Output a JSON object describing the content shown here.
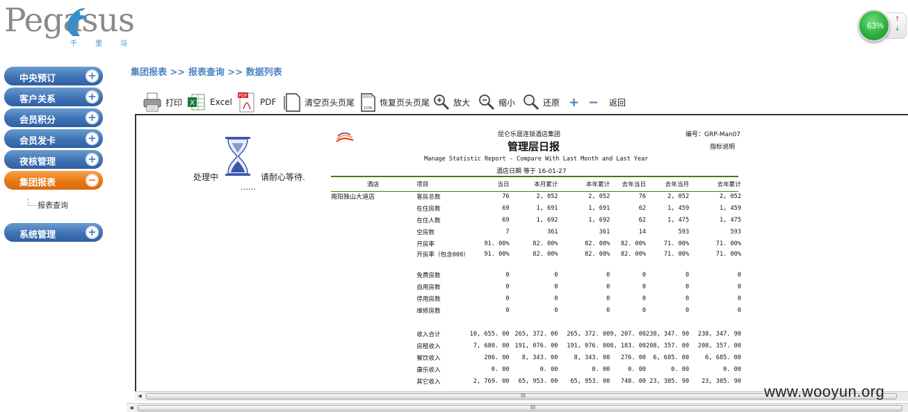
{
  "logo": {
    "text": "Pegasus",
    "subtitle": "千里马"
  },
  "gauge": {
    "value": "63%",
    "color": "#2fae3f"
  },
  "sidebar": {
    "items": [
      {
        "label": "中央预订",
        "icon": "plus-icon"
      },
      {
        "label": "客户关系",
        "icon": "plus-icon"
      },
      {
        "label": "会员积分",
        "icon": "plus-icon"
      },
      {
        "label": "会员发卡",
        "icon": "plus-icon"
      },
      {
        "label": "夜核管理",
        "icon": "plus-icon"
      },
      {
        "label": "集团报表",
        "icon": "minus-icon",
        "active": true
      },
      {
        "label": "系统管理",
        "icon": "plus-icon"
      }
    ],
    "sub_item": "报表查询",
    "colors": {
      "normal": "#3f72b4",
      "active": "#e77716"
    }
  },
  "breadcrumb": "集团报表 >> 报表查询 >> 数据列表",
  "toolbar": {
    "print": "打印",
    "excel": "Excel",
    "pdf": "PDF",
    "clear_header": "清空页头页尾",
    "restore_header": "恢复页头页尾",
    "zoom_in": "放大",
    "zoom_out": "缩小",
    "reset": "还原",
    "plus": "+",
    "minus": "−",
    "back": "返回"
  },
  "loading": {
    "left": "处理中",
    "right": "请耐心等待.",
    "dots": "……"
  },
  "report": {
    "group": "昆仑乐居连锁酒店集团",
    "code": "编号：GRP-Man07",
    "title": "管理层日报",
    "description_link": "指标说明",
    "subtitle": "Manage Statistic Report - Compare With Last Month and Last Year",
    "date": "酒店日期 等于 16-01-27",
    "headers": [
      "酒店",
      "项目",
      "当日",
      "本月累计",
      "本年累计",
      "去年当日",
      "去年当月",
      "去年累计"
    ],
    "hotel": "南阳独山大道店",
    "rows": [
      [
        "客房总数",
        "76",
        "2, 052",
        "2, 052",
        "76",
        "2, 052",
        "2, 052"
      ],
      [
        "在住房数",
        "69",
        "1, 691",
        "1, 691",
        "62",
        "1, 459",
        "1, 459"
      ],
      [
        "在住人数",
        "69",
        "1, 692",
        "1, 692",
        "62",
        "1, 475",
        "1, 475"
      ],
      [
        "空房数",
        "7",
        "361",
        "361",
        "14",
        "593",
        "593"
      ],
      [
        "开房率",
        "91. 00%",
        "82. 00%",
        "82. 00%",
        "82. 00%",
        "71. 00%",
        "71. 00%"
      ],
      [
        "开房率（包含000）",
        "91. 00%",
        "82. 00%",
        "82. 00%",
        "82. 00%",
        "71. 00%",
        "71. 00%"
      ],
      [
        "免费房数",
        "0",
        "0",
        "0",
        "0",
        "0",
        "0"
      ],
      [
        "自用房数",
        "0",
        "0",
        "0",
        "0",
        "0",
        "0"
      ],
      [
        "停用房数",
        "0",
        "0",
        "0",
        "0",
        "0",
        "0"
      ],
      [
        "维修房数",
        "0",
        "0",
        "0",
        "0",
        "0",
        "0"
      ],
      [
        "",
        "",
        "",
        "",
        "",
        "",
        ""
      ],
      [
        "收入合计",
        "10, 655. 00",
        "265, 372. 00",
        "265, 372. 00",
        "9, 207. 00",
        "238, 347. 90",
        "238, 347. 90"
      ],
      [
        "房租收入",
        "7, 680. 00",
        "191, 076. 00",
        "191, 076. 00",
        "8, 183. 00",
        "208, 357. 00",
        "208, 357. 00"
      ],
      [
        "餐饮收入",
        "206. 00",
        "8, 343. 00",
        "8, 343. 00",
        "276. 00",
        "6, 685. 00",
        "6, 685. 00"
      ],
      [
        "康乐收入",
        "0. 00",
        "0. 00",
        "0. 00",
        "0. 00",
        "0. 00",
        "0. 00"
      ],
      [
        "其它收入",
        "2, 769. 00",
        "65, 953. 00",
        "65, 953. 00",
        "748. 00",
        "23, 305. 90",
        "23, 305. 90"
      ]
    ],
    "line_color": "#3a7d1e"
  },
  "scrollbar": {
    "grip": "III"
  },
  "watermark": "www.wooyun.org"
}
